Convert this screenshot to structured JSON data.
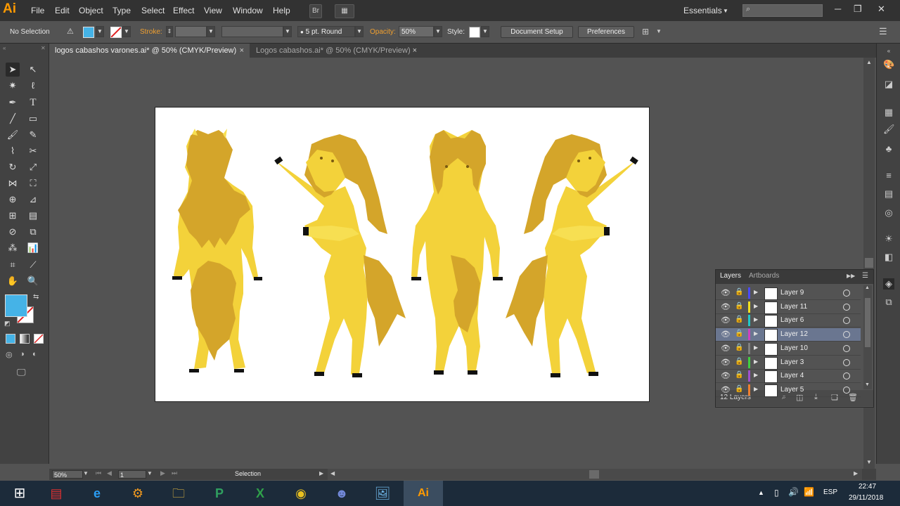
{
  "app": {
    "logo": "Ai"
  },
  "menu": [
    "File",
    "Edit",
    "Object",
    "Type",
    "Select",
    "Effect",
    "View",
    "Window",
    "Help"
  ],
  "menu_buttons": {
    "bridge": "Br",
    "arrange": "▦"
  },
  "workspace": {
    "label": "Essentials",
    "search_placeholder": ""
  },
  "control": {
    "selection_label": "No Selection",
    "fill_color": "#45b3e7",
    "stroke_label": "Stroke:",
    "brush": "5 pt. Round",
    "opacity_label": "Opacity:",
    "opacity_value": "50%",
    "style_label": "Style:",
    "document_setup": "Document Setup",
    "preferences": "Preferences"
  },
  "tabs": [
    {
      "label": "logos cabashos varones.ai* @ 50% (CMYK/Preview)",
      "close": "×"
    },
    {
      "label": "Logos cabashos.ai* @ 50% (CMYK/Preview)",
      "close": "×"
    }
  ],
  "layers_panel": {
    "tabs": [
      "Layers",
      "Artboards"
    ],
    "layers": [
      {
        "name": "Layer 9",
        "color": "#4a4aff"
      },
      {
        "name": "Layer 11",
        "color": "#f0e020"
      },
      {
        "name": "Layer 6",
        "color": "#20c8c8"
      },
      {
        "name": "Layer 12",
        "color": "#d040c0"
      },
      {
        "name": "Layer 10",
        "color": "#808080"
      },
      {
        "name": "Layer 3",
        "color": "#40d040"
      },
      {
        "name": "Layer 4",
        "color": "#a050d0"
      },
      {
        "name": "Layer 5",
        "color": "#f08030"
      }
    ],
    "count": "12 Layers"
  },
  "status": {
    "zoom": "50%",
    "page": "1",
    "mode": "Selection"
  },
  "taskbar": {
    "lang": "ESP",
    "time": "22:47",
    "date": "29/11/2018"
  },
  "colors": {
    "horse_dark": "#d4a52a",
    "horse_light": "#f3d23a",
    "horse_bright": "#f7df52",
    "hoof": "#111111"
  }
}
